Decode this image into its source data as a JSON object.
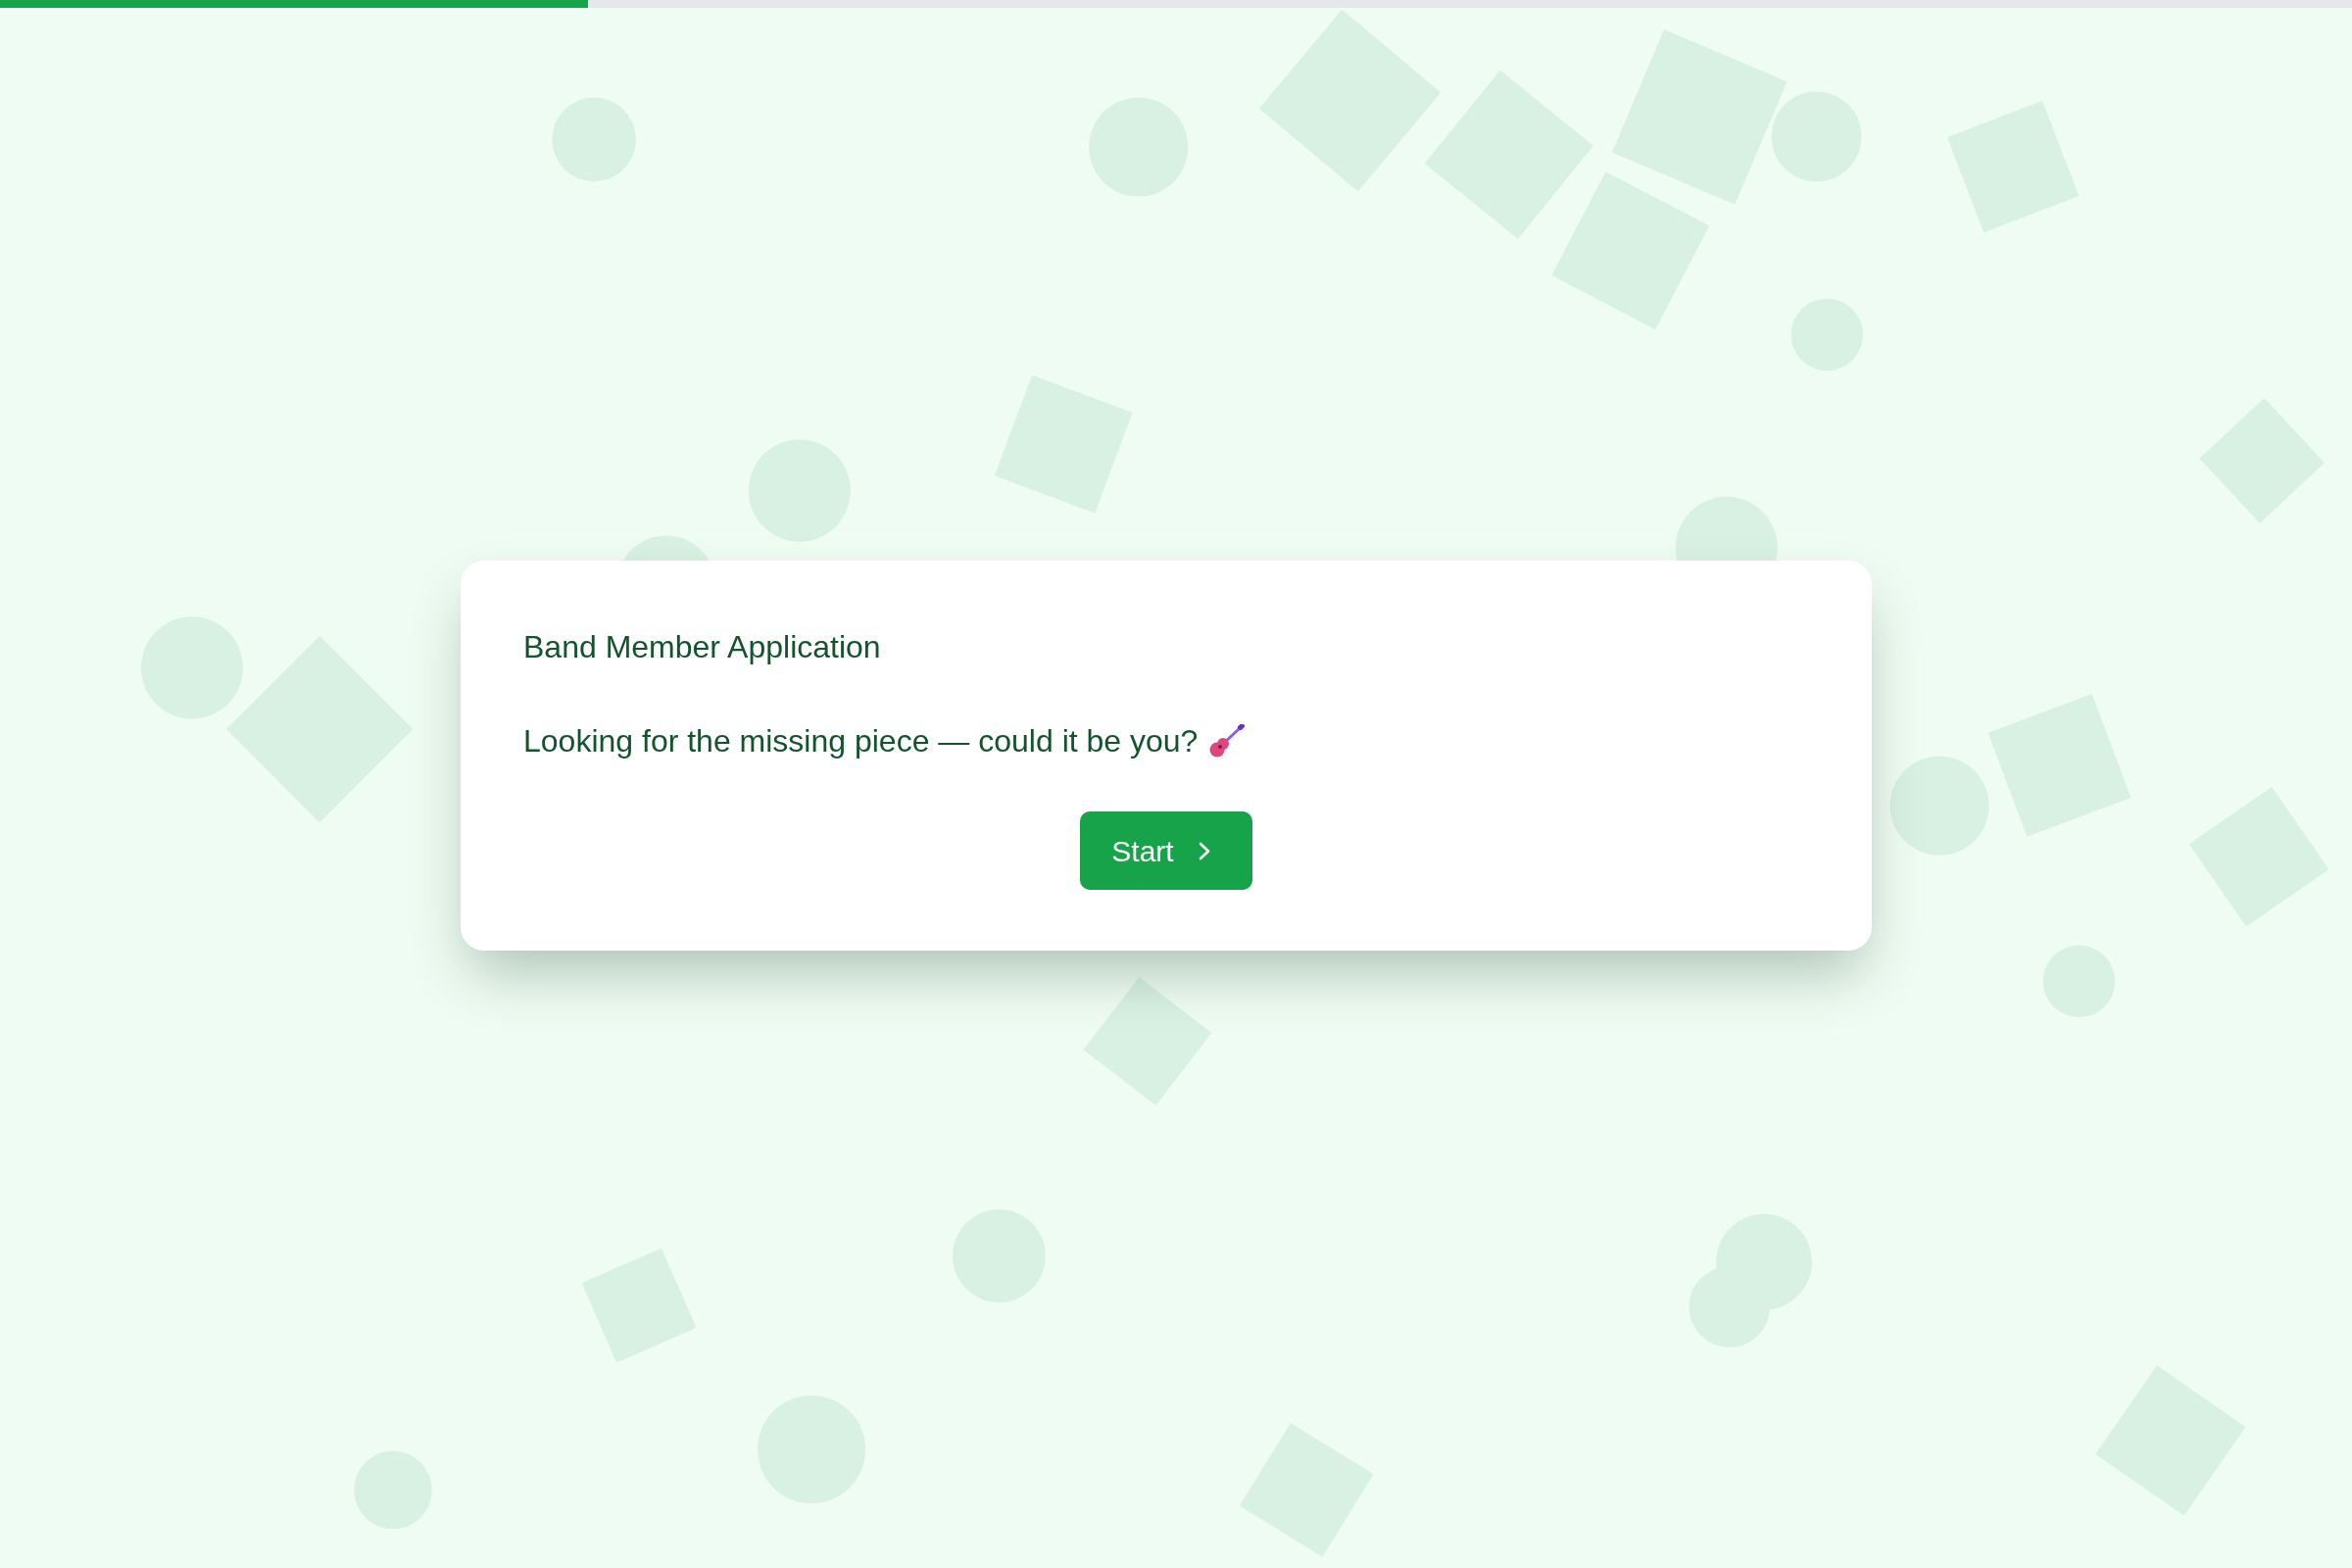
{
  "progress": {
    "level": 0.25
  },
  "card": {
    "title": "Band Member Application",
    "description": "Looking for the missing piece — could it be you?",
    "start_button": {
      "label": "Start"
    }
  }
}
